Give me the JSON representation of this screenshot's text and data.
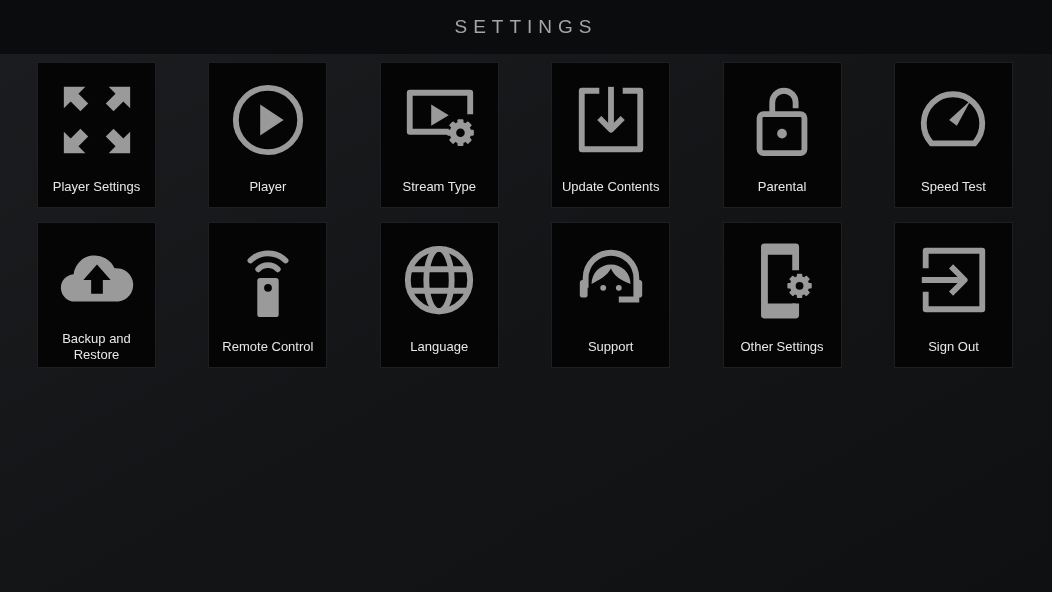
{
  "header": {
    "title": "SETTINGS"
  },
  "tiles": [
    {
      "label": "Player Settings"
    },
    {
      "label": "Player"
    },
    {
      "label": "Stream Type"
    },
    {
      "label": "Update Contents"
    },
    {
      "label": "Parental"
    },
    {
      "label": "Speed Test"
    },
    {
      "label": "Backup and Restore"
    },
    {
      "label": "Remote Control"
    },
    {
      "label": "Language"
    },
    {
      "label": "Support"
    },
    {
      "label": "Other Settings"
    },
    {
      "label": "Sign Out"
    }
  ]
}
